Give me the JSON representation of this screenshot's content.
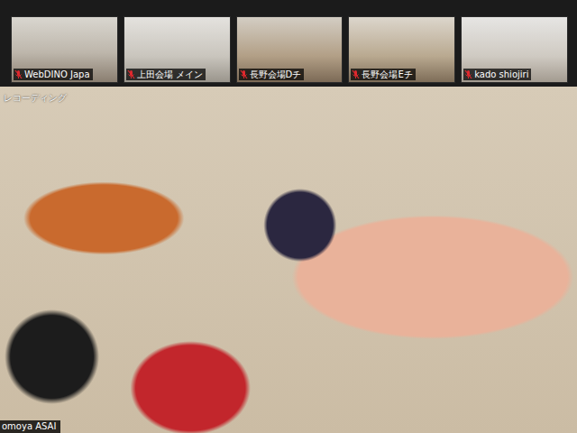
{
  "gallery": [
    {
      "name": "WebDINO Japa",
      "muted": true
    },
    {
      "name": "上田会場 メイン",
      "muted": true
    },
    {
      "name": "長野会場Dチ",
      "muted": true
    },
    {
      "name": "長野会場Eチ",
      "muted": true
    },
    {
      "name": "kado shiojiri",
      "muted": true
    }
  ],
  "recording": {
    "label": "レコーディング"
  },
  "speaker": {
    "name": "omoya ASAI"
  }
}
